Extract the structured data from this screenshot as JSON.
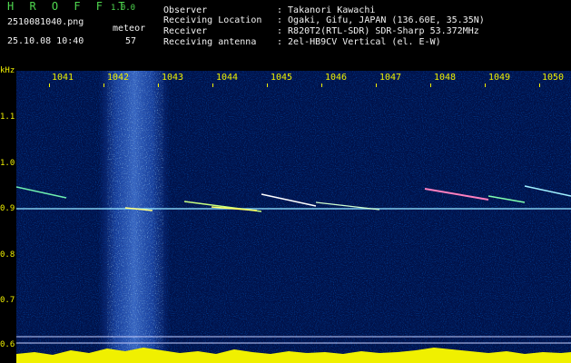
{
  "header": {
    "app_title": "H R O F F T",
    "app_version": "1.0.0",
    "filename": "2510081040.png",
    "datetime": "25.10.08 10:40",
    "meteor_label": "meteor",
    "meteor_count": "57",
    "rows": [
      {
        "label": "Observer",
        "value": ": Takanori Kawachi"
      },
      {
        "label": "Receiving Location",
        "value": ": Ogaki, Gifu, JAPAN (136.60E, 35.35N)"
      },
      {
        "label": "Receiver",
        "value": ": R820T2(RTL-SDR) SDR-Sharp 53.372MHz"
      },
      {
        "label": "Receiving antenna",
        "value": ": 2el-HB9CV Vertical (el. E-W)"
      }
    ]
  },
  "axes": {
    "y_unit": "kHz",
    "y_ticks": [
      "1.1",
      "1.0",
      "0.9",
      "0.8",
      "0.7",
      "0.6"
    ],
    "x_ticks": [
      "1041",
      "1042",
      "1043",
      "1044",
      "1045",
      "1046",
      "1047",
      "1048",
      "1049",
      "1050"
    ]
  },
  "colors": {
    "background": "#000000",
    "header_green": "#4fd84f",
    "header_white": "#f2f2f2",
    "axis_yellow": "#f0f000",
    "spectrum_base": "#00113a"
  }
}
